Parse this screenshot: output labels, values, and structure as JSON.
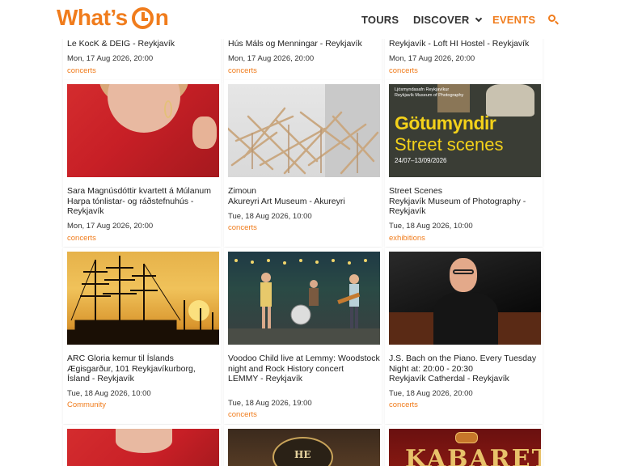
{
  "header": {
    "logo_text": "What's On",
    "nav": {
      "tours": "TOURS",
      "discover": "DISCOVER",
      "events": "EVENTS"
    },
    "accent_color": "#f07c1c",
    "search_icon": "search-icon"
  },
  "top_row": [
    {
      "title": "Le KocK & DEIG - Reykjavík",
      "date": "Mon, 17 Aug 2026, 20:00",
      "tag": "concerts"
    },
    {
      "title": "Hús Máls og Menningar - Reykjavík",
      "date": "Mon, 17 Aug 2026, 20:00",
      "tag": "concerts"
    },
    {
      "title": "Reykjavík - Loft HI Hostel - Reykjavík",
      "date": "Mon, 17 Aug 2026, 20:00",
      "tag": "concerts"
    }
  ],
  "row2": [
    {
      "title": "Sara Magnúsdóttir kvartett á Múlanum\nHarpa tónlistar- og ráðstefnuhús - Reykjavík",
      "date": "Mon, 17 Aug 2026, 20:00",
      "tag": "concerts"
    },
    {
      "title": "Zimoun\nAkureyri Art Museum - Akureyri",
      "date": "Tue, 18 Aug 2026, 10:00",
      "tag": "concerts"
    },
    {
      "title": "Street Scenes\nReykjavík Museum of Photography - Reykjavík",
      "date": "Tue, 18 Aug 2026, 10:00",
      "tag": "exhibitions",
      "poster": {
        "small": "Ljósmyndasafn Reykjavíkur\nReykjavík Museum of Photography",
        "line1": "Götumyndir",
        "line2": "Street scenes",
        "dates": "24/07–13/09/2026"
      }
    }
  ],
  "row3": [
    {
      "title": "ARC Gloria kemur til Íslands\nÆgisgarður, 101 Reykjavíkurborg, Ísland - Reykjavík",
      "date": "Tue, 18 Aug 2026, 10:00",
      "tag": "Community"
    },
    {
      "title": "Voodoo Child live at Lemmy: Woodstock night and Rock History concert\nLEMMY - Reykjavík",
      "date": "Tue, 18 Aug 2026, 19:00",
      "tag": "concerts"
    },
    {
      "title": "J.S. Bach on the Piano. Every Tuesday Night at: 20:00 - 20:30\nReykjavík Catherdal - Reykjavík",
      "date": "Tue, 18 Aug 2026, 20:00",
      "tag": "concerts"
    }
  ],
  "row4": [
    {
      "image": "portrait"
    },
    {
      "image": "books",
      "logo_text": "HE"
    },
    {
      "image": "kabarett",
      "poster_word": "KABARETT"
    }
  ]
}
